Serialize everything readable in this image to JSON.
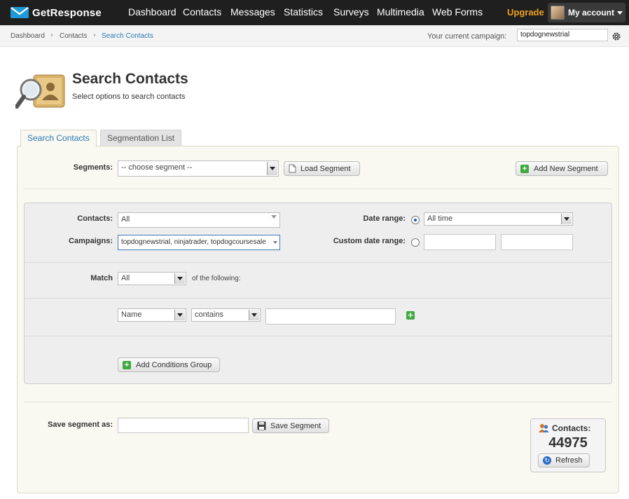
{
  "brand": {
    "name": "GetResponse"
  },
  "nav": {
    "items": [
      {
        "label": "Dashboard"
      },
      {
        "label": "Contacts"
      },
      {
        "label": "Messages"
      },
      {
        "label": "Statistics"
      },
      {
        "label": "Surveys"
      },
      {
        "label": "Multimedia"
      },
      {
        "label": "Web Forms"
      }
    ],
    "upgrade": "Upgrade",
    "account": "My account"
  },
  "breadcrumb": {
    "items": [
      "Dashboard",
      "Contacts",
      "Search Contacts"
    ],
    "separator": "›"
  },
  "campaign": {
    "label": "Your current campaign:",
    "value": "topdognewstrial"
  },
  "header": {
    "title": "Search Contacts",
    "subtitle": "Select options to search contacts"
  },
  "tabs": [
    {
      "label": "Search Contacts",
      "active": true
    },
    {
      "label": "Segmentation List",
      "active": false
    }
  ],
  "segments": {
    "label": "Segments:",
    "selected": "-- choose segment --",
    "load_button": "Load Segment",
    "add_button": "Add New Segment"
  },
  "filters": {
    "contacts_label": "Contacts:",
    "contacts_value": "All",
    "campaigns_label": "Campaigns:",
    "campaigns_value": "topdognewstrial, ninjatrader, topdogcoursesale",
    "date_range_label": "Date range:",
    "date_range_value": "All time",
    "custom_date_label": "Custom date range:",
    "custom_from": "",
    "custom_to": ""
  },
  "match": {
    "label": "Match",
    "value": "All",
    "suffix": "of the following:"
  },
  "condition": {
    "field": "Name",
    "operator": "contains",
    "value": ""
  },
  "conditions_group": {
    "add_button": "Add Conditions Group"
  },
  "save": {
    "label": "Save segment as:",
    "value": "",
    "button": "Save Segment"
  },
  "contacts_count": {
    "label": "Contacts:",
    "value": "44975",
    "refresh": "Refresh"
  },
  "colors": {
    "accent": "#2a7ab8",
    "upgrade": "#f0a020",
    "nav_bg": "#1f1f1f",
    "panel_bg": "#f9f8f1"
  }
}
